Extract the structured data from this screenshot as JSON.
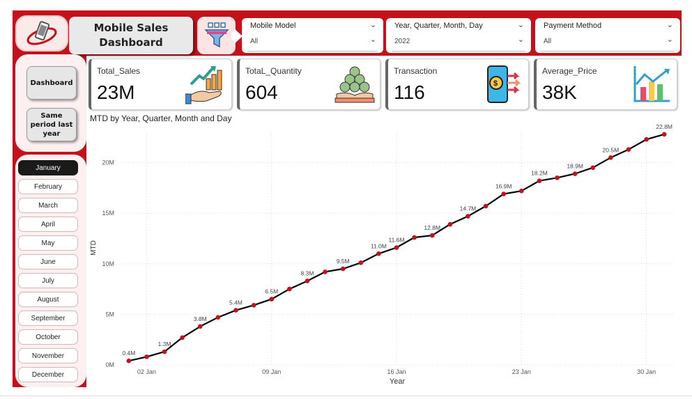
{
  "header": {
    "title_line1": "Mobile Sales",
    "title_line2": "Dashboard"
  },
  "slicers": [
    {
      "title": "Mobile Model",
      "value": "All"
    },
    {
      "title": "Year, Quarter, Month, Day",
      "value": "2022"
    },
    {
      "title": "Payment Method",
      "value": "All"
    }
  ],
  "nav": {
    "dashboard_label": "Dashboard",
    "same_period_label": "Same period last year"
  },
  "months": [
    "January",
    "February",
    "March",
    "April",
    "May",
    "June",
    "July",
    "August",
    "September",
    "October",
    "November",
    "December"
  ],
  "selected_month": "January",
  "kpis": [
    {
      "label": "Total_Sales",
      "value": "23M",
      "icon": "growth-hand-icon"
    },
    {
      "label": "TotaL_Quantity",
      "value": "604",
      "icon": "coins-hand-icon"
    },
    {
      "label": "Transaction",
      "value": "116",
      "icon": "phone-payment-icon"
    },
    {
      "label": "Average_Price",
      "value": "38K",
      "icon": "bar-chart-icon"
    }
  ],
  "chart_data": {
    "type": "line",
    "title": "MTD by Year, Quarter, Month and Day",
    "xlabel": "Year",
    "ylabel": "MTD",
    "ylim": [
      0,
      23
    ],
    "y_ticks": [
      0,
      5,
      10,
      15,
      20
    ],
    "y_tick_labels": [
      "0M",
      "5M",
      "10M",
      "15M",
      "20M"
    ],
    "x_ticks": [
      2,
      9,
      16,
      23,
      30
    ],
    "x_tick_labels": [
      "02 Jan",
      "09 Jan",
      "16 Jan",
      "23 Jan",
      "30 Jan"
    ],
    "grid": true,
    "line_color": "#000000",
    "marker_color": "#c4111a",
    "x": [
      1,
      2,
      3,
      4,
      5,
      6,
      7,
      8,
      9,
      10,
      11,
      12,
      13,
      14,
      15,
      16,
      17,
      18,
      19,
      20,
      21,
      22,
      23,
      24,
      25,
      26,
      27,
      28,
      29,
      30,
      31
    ],
    "values": [
      0.4,
      0.8,
      1.3,
      2.7,
      3.8,
      4.7,
      5.4,
      5.9,
      6.5,
      7.5,
      8.3,
      9.2,
      9.5,
      10.1,
      11.0,
      11.6,
      12.6,
      12.8,
      13.9,
      14.7,
      15.7,
      16.9,
      17.2,
      18.2,
      18.5,
      18.9,
      19.5,
      20.5,
      21.3,
      22.3,
      22.8
    ],
    "data_labels": [
      {
        "x": 1,
        "text": "0.4M"
      },
      {
        "x": 3,
        "text": "1.3M"
      },
      {
        "x": 5,
        "text": "3.8M"
      },
      {
        "x": 7,
        "text": "5.4M"
      },
      {
        "x": 9,
        "text": "6.5M"
      },
      {
        "x": 11,
        "text": "8.3M"
      },
      {
        "x": 13,
        "text": "9.5M"
      },
      {
        "x": 15,
        "text": "11.0M"
      },
      {
        "x": 16,
        "text": "11.6M"
      },
      {
        "x": 18,
        "text": "12.8M"
      },
      {
        "x": 20,
        "text": "14.7M"
      },
      {
        "x": 22,
        "text": "16.9M"
      },
      {
        "x": 24,
        "text": "18.2M"
      },
      {
        "x": 26,
        "text": "18.9M"
      },
      {
        "x": 28,
        "text": "20.5M"
      },
      {
        "x": 31,
        "text": "22.8M"
      }
    ]
  }
}
